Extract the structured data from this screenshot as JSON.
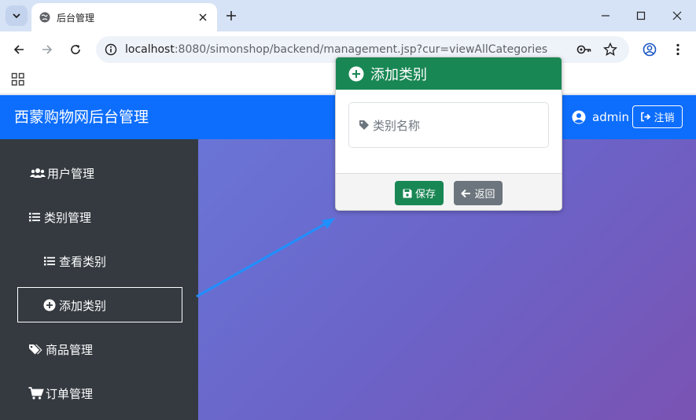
{
  "browser": {
    "tab_title": "后台管理",
    "url_host": "localhost",
    "url_rest": ":8080/simonshop/backend/management.jsp?cur=viewAllCategories"
  },
  "navbar": {
    "brand": "西蒙购物网后台管理",
    "user": "admin",
    "logout_label": "注销",
    "color": "#0d6efd"
  },
  "sidebar": {
    "items": [
      {
        "label": "用户管理",
        "icon": "users-icon"
      },
      {
        "label": "类别管理",
        "icon": "list-icon"
      },
      {
        "label": "查看类别",
        "icon": "list-icon"
      },
      {
        "label": "添加类别",
        "icon": "plus-circle-icon",
        "active": true
      },
      {
        "label": "商品管理",
        "icon": "tags-icon"
      },
      {
        "label": "订单管理",
        "icon": "cart-icon"
      }
    ]
  },
  "card": {
    "title": "添加类别",
    "field_placeholder": "类别名称",
    "save_label": "保存",
    "back_label": "返回",
    "header_color": "#198754",
    "back_color": "#6c757d"
  }
}
